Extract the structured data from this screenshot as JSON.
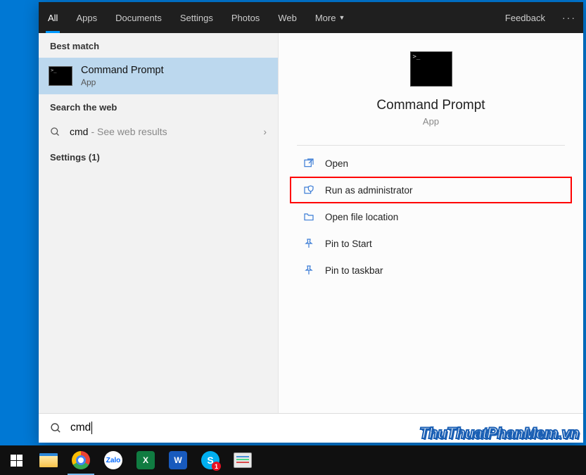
{
  "tabs": {
    "all": "All",
    "apps": "Apps",
    "documents": "Documents",
    "settings": "Settings",
    "photos": "Photos",
    "web": "Web",
    "more": "More"
  },
  "feedback": "Feedback",
  "left": {
    "best_match_header": "Best match",
    "best_match": {
      "title": "Command Prompt",
      "subtitle": "App"
    },
    "search_web_header": "Search the web",
    "web_result": {
      "term": "cmd",
      "hint": "- See web results"
    },
    "settings_header": "Settings (1)"
  },
  "right": {
    "title": "Command Prompt",
    "subtitle": "App",
    "actions": {
      "open": "Open",
      "run_admin": "Run as administrator",
      "open_location": "Open file location",
      "pin_start": "Pin to Start",
      "pin_taskbar": "Pin to taskbar"
    }
  },
  "search": {
    "query": "cmd"
  },
  "taskbar": {
    "zalo": "Zalo",
    "excel": "X",
    "word": "W",
    "skype": "S",
    "skype_badge": "1"
  },
  "watermark": "ThuThuatPhanMem.vn"
}
